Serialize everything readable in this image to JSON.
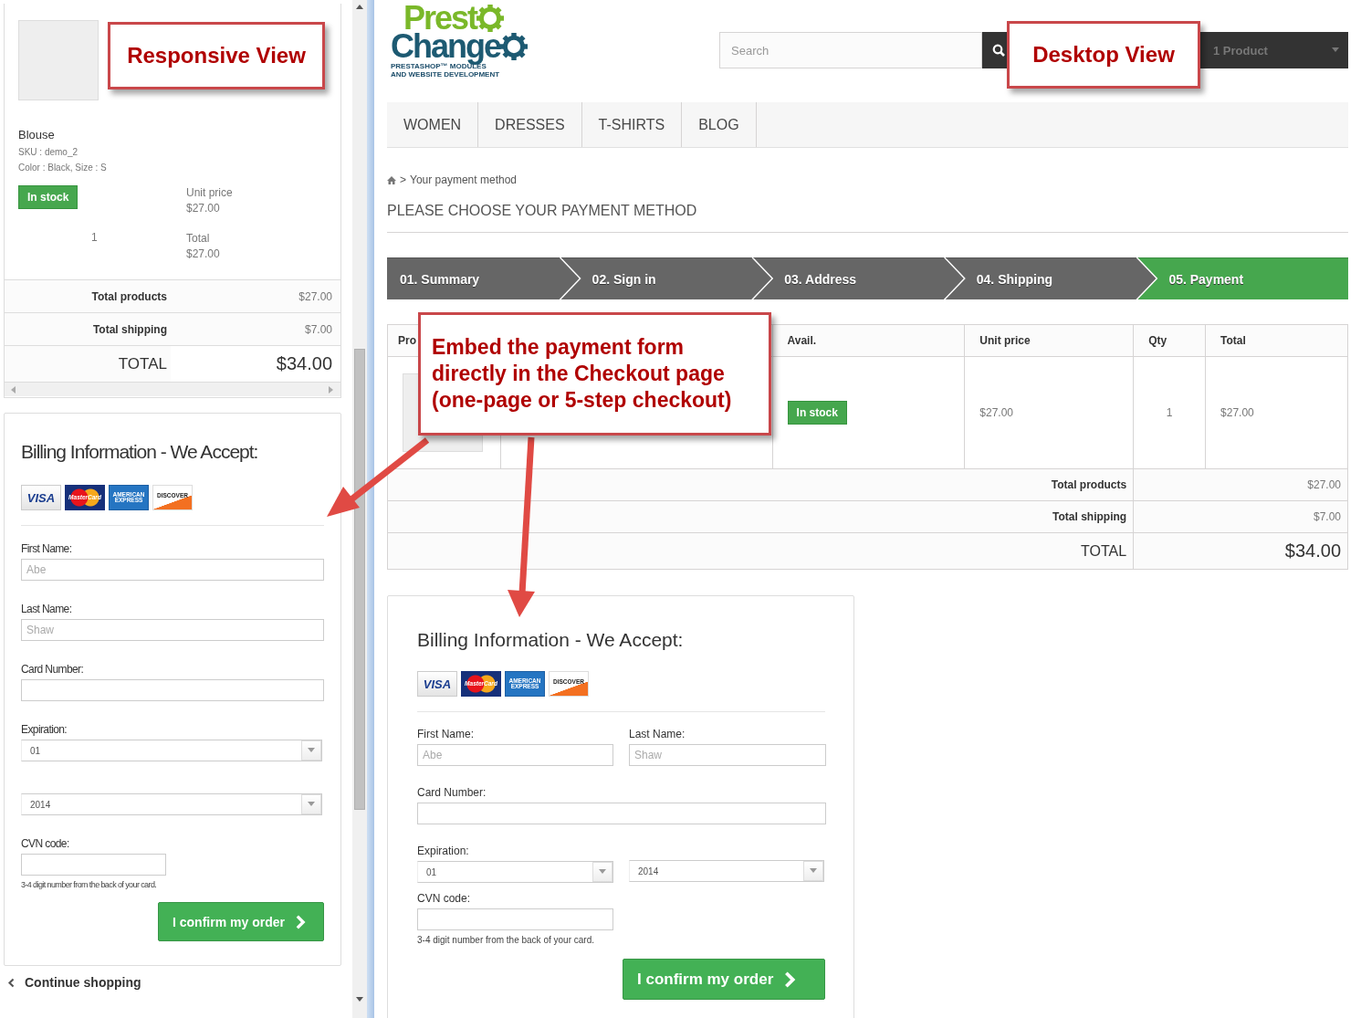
{
  "responsive_view": {
    "product": {
      "name": "Blouse",
      "sku": "SKU : demo_2",
      "attributes": "Color : Black, Size : S",
      "availability": "In stock",
      "unit_price_label": "Unit price",
      "unit_price": "$27.00",
      "quantity": "1",
      "total_label": "Total",
      "total": "$27.00"
    },
    "totals": [
      {
        "kind": "sub",
        "label": "Total products",
        "value": "$27.00"
      },
      {
        "kind": "sub",
        "label": "Total shipping",
        "value": "$7.00"
      },
      {
        "kind": "grand",
        "label": "TOTAL",
        "value": "$34.00"
      }
    ],
    "billing": {
      "title": "Billing Information - We Accept:",
      "cards": [
        {
          "kind": "visa",
          "text": "VISA"
        },
        {
          "kind": "mastercard",
          "text": "MasterCard"
        },
        {
          "kind": "amex",
          "text": "AMERICAN EXPRESS"
        },
        {
          "kind": "discover",
          "text": "DISCOVER"
        }
      ],
      "first_name": {
        "label": "First Name:",
        "placeholder": "Abe"
      },
      "last_name": {
        "label": "Last Name:",
        "placeholder": "Shaw"
      },
      "card_number": {
        "label": "Card Number:"
      },
      "expiration": {
        "label": "Expiration:",
        "month": "01",
        "year": "2014"
      },
      "cvn": {
        "label": "CVN code:",
        "hint": "3-4 digit number from the back of your card."
      },
      "button": "I confirm my order"
    },
    "continue_link": "Continue shopping"
  },
  "desktop_view": {
    "logo": {
      "line_1": "Prest",
      "line_2": "Change",
      "tagline": [
        "PRESTASHOP™ MODULES",
        "AND WEBSITE DEVELOPMENT"
      ]
    },
    "search": {
      "placeholder": "Search"
    },
    "cart": {
      "label": "1 Product"
    },
    "nav": [
      "WOMEN",
      "DRESSES",
      "T-SHIRTS",
      "BLOG"
    ],
    "breadcrumb_separator": ">",
    "breadcrumb": "Your payment method",
    "heading": "PLEASE CHOOSE YOUR PAYMENT METHOD",
    "steps": [
      {
        "label": "01. Summary",
        "selected": false
      },
      {
        "label": "02. Sign in",
        "selected": false
      },
      {
        "label": "03. Address",
        "selected": false
      },
      {
        "label": "04. Shipping",
        "selected": false
      },
      {
        "label": "05. Payment",
        "selected": true
      }
    ],
    "table": {
      "columns": [
        "Pro",
        "",
        "Avail.",
        "Unit price",
        "Qty",
        "Total"
      ],
      "row": {
        "availability": "In stock",
        "unit_price": "$27.00",
        "quantity": "1",
        "total": "$27.00"
      },
      "totals": [
        {
          "kind": "sub",
          "label": "Total products",
          "value": "$27.00"
        },
        {
          "kind": "sub",
          "label": "Total shipping",
          "value": "$7.00"
        },
        {
          "kind": "grand",
          "label": "TOTAL",
          "value": "$34.00"
        }
      ]
    },
    "billing": {
      "title": "Billing Information - We Accept:",
      "cards": [
        {
          "kind": "visa",
          "text": "VISA"
        },
        {
          "kind": "mastercard",
          "text": "MasterCard"
        },
        {
          "kind": "amex",
          "text": "AMERICAN EXPRESS"
        },
        {
          "kind": "discover",
          "text": "DISCOVER"
        }
      ],
      "first_name": {
        "label": "First Name:",
        "placeholder": "Abe"
      },
      "last_name": {
        "label": "Last Name:",
        "placeholder": "Shaw"
      },
      "card_number": {
        "label": "Card Number:"
      },
      "expiration": {
        "label": "Expiration:",
        "month": "01",
        "year": "2014"
      },
      "cvn": {
        "label": "CVN code:",
        "hint": "3-4 digit number from the back of your card."
      },
      "button": "I confirm my order"
    }
  },
  "annotations": [
    {
      "kind": "responsive",
      "text": "Responsive View"
    },
    {
      "kind": "desktop",
      "text": "Desktop View"
    },
    {
      "kind": "embed",
      "text": "Embed the payment form directly in the Checkout page (one-page or 5-step checkout)"
    }
  ]
}
